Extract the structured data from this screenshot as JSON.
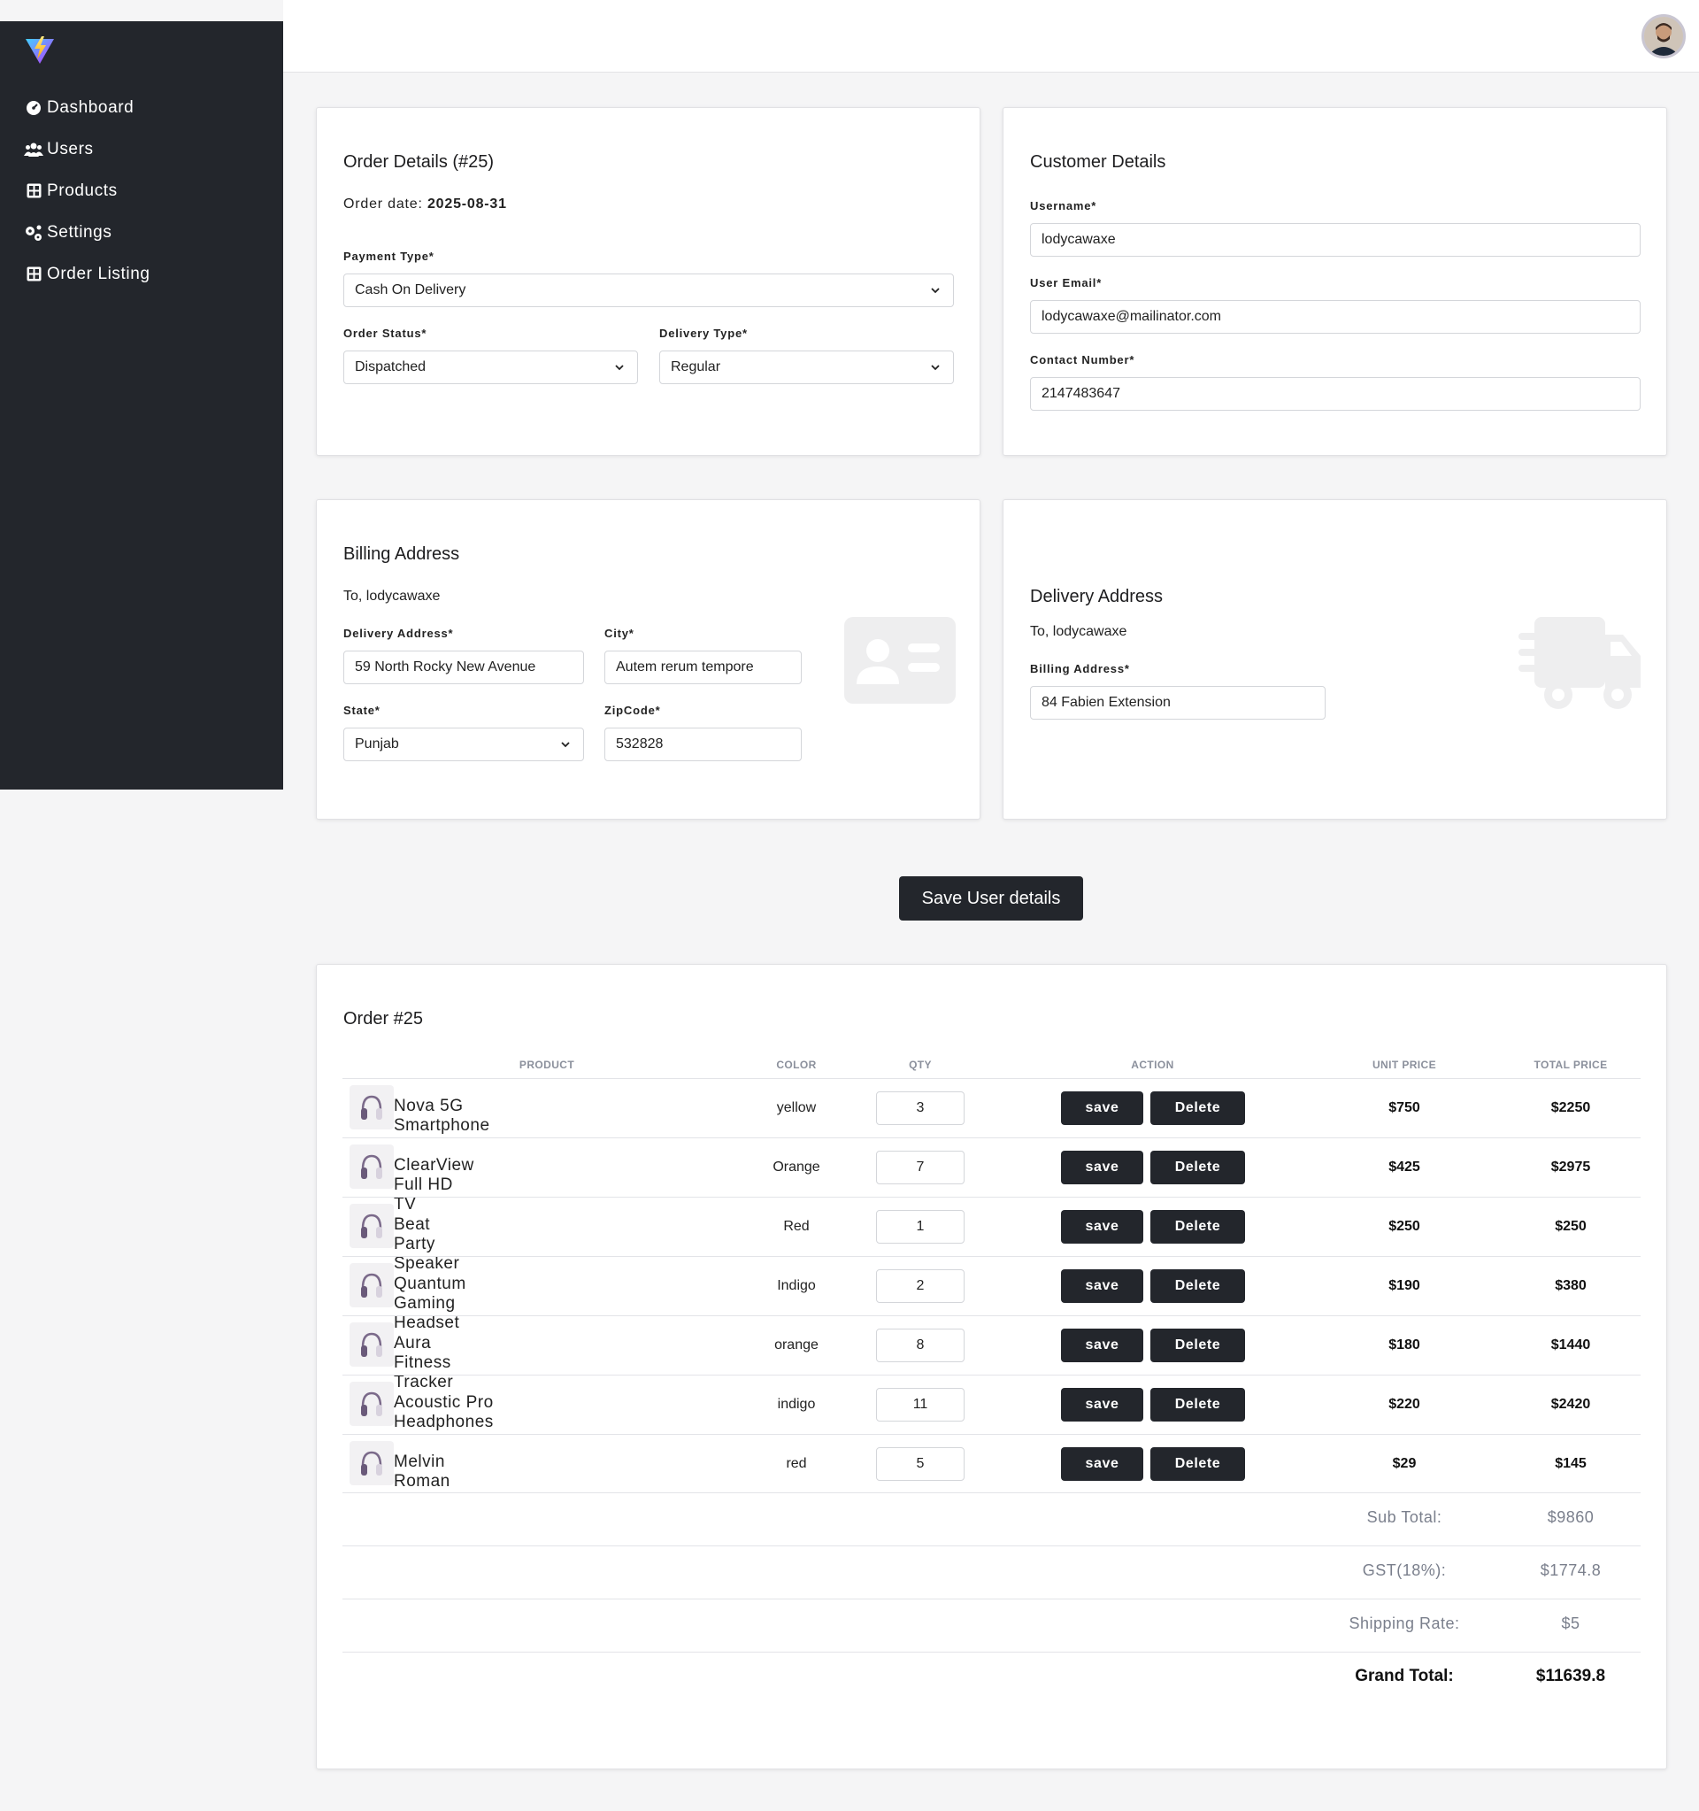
{
  "sidebar": {
    "items": [
      {
        "label": "Dashboard",
        "icon": "gauge-icon"
      },
      {
        "label": "Users",
        "icon": "users-icon"
      },
      {
        "label": "Products",
        "icon": "grid-icon"
      },
      {
        "label": "Settings",
        "icon": "gears-icon"
      },
      {
        "label": "Order Listing",
        "icon": "grid-icon"
      }
    ]
  },
  "order_details": {
    "title": "Order Details (#25)",
    "order_date_label": "Order date:",
    "order_date": "2025-08-31",
    "payment_type_label": "Payment Type*",
    "payment_type": "Cash On Delivery",
    "order_status_label": "Order Status*",
    "order_status": "Dispatched",
    "delivery_type_label": "Delivery Type*",
    "delivery_type": "Regular"
  },
  "customer_details": {
    "title": "Customer Details",
    "username_label": "Username*",
    "username": "lodycawaxe",
    "email_label": "User Email*",
    "email": "lodycawaxe@mailinator.com",
    "contact_label": "Contact Number*",
    "contact": "2147483647"
  },
  "billing_address": {
    "title": "Billing Address",
    "to_line": "To, lodycawaxe",
    "delivery_address_label": "Delivery Address*",
    "delivery_address": "59 North Rocky New Avenue",
    "city_label": "City*",
    "city": "Autem rerum tempore",
    "state_label": "State*",
    "state": "Punjab",
    "zip_label": "ZipCode*",
    "zip": "532828"
  },
  "delivery_address": {
    "title": "Delivery Address",
    "to_line": "To, lodycawaxe",
    "billing_address_label": "Billing Address*",
    "billing_address": "84 Fabien Extension"
  },
  "save_user_button": "Save User details",
  "order": {
    "title": "Order #25",
    "columns": [
      "PRODUCT",
      "COLOR",
      "QTY",
      "ACTION",
      "UNIT PRICE",
      "TOTAL PRICE"
    ],
    "save_label": "save",
    "delete_label": "Delete",
    "rows": [
      {
        "product": "Nova 5G Smartphone",
        "color": "yellow",
        "qty": "3",
        "unit_price": "$750",
        "total_price": "$2250"
      },
      {
        "product": "ClearView Full HD TV",
        "color": "Orange",
        "qty": "7",
        "unit_price": "$425",
        "total_price": "$2975"
      },
      {
        "product": "Beat Party Speaker",
        "color": "Red",
        "qty": "1",
        "unit_price": "$250",
        "total_price": "$250"
      },
      {
        "product": "Quantum Gaming Headset",
        "color": "Indigo",
        "qty": "2",
        "unit_price": "$190",
        "total_price": "$380"
      },
      {
        "product": "Aura Fitness Tracker",
        "color": "orange",
        "qty": "8",
        "unit_price": "$180",
        "total_price": "$1440"
      },
      {
        "product": "Acoustic Pro Headphones",
        "color": "indigo",
        "qty": "11",
        "unit_price": "$220",
        "total_price": "$2420"
      },
      {
        "product": "Melvin Roman",
        "color": "red",
        "qty": "5",
        "unit_price": "$29",
        "total_price": "$145"
      }
    ],
    "summary": {
      "sub_total_label": "Sub Total:",
      "sub_total": "$9860",
      "gst_label": "GST(18%):",
      "gst": "$1774.8",
      "shipping_label": "Shipping Rate:",
      "shipping": "$5",
      "grand_total_label": "Grand Total:",
      "grand_total": "$11639.8"
    }
  },
  "colors": {
    "sidebar_bg": "#23262c",
    "button_bg": "#23262c",
    "page_bg": "#f5f5f6"
  }
}
